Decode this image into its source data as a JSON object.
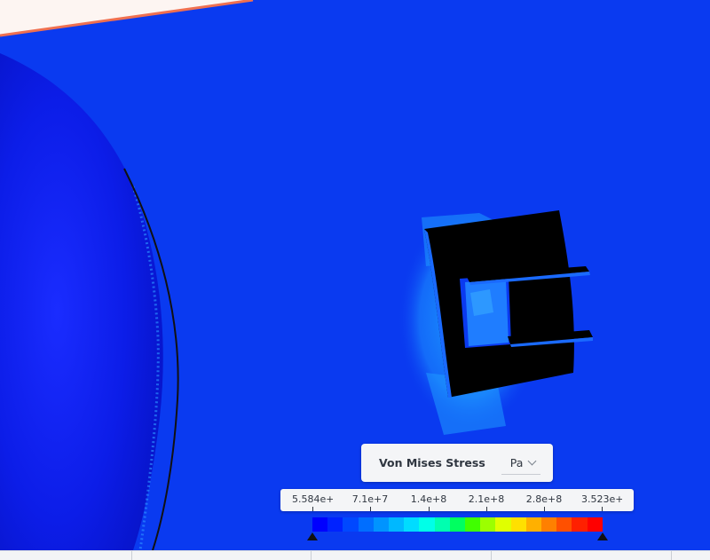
{
  "result_panel": {
    "quantity_label": "Von Mises Stress",
    "unit": "Pa"
  },
  "legend": {
    "labels": [
      "5.584e+5",
      "7.1e+7",
      "1.4e+8",
      "2.1e+8",
      "2.8e+8",
      "3.523e+8"
    ],
    "colors": [
      "#0000ff",
      "#0022ff",
      "#0048ff",
      "#006eff",
      "#0094ff",
      "#00b8ff",
      "#00dcff",
      "#00ffe8",
      "#00ffb0",
      "#00ff60",
      "#40ff00",
      "#9cff00",
      "#e0ff00",
      "#ffe000",
      "#ffb000",
      "#ff8000",
      "#ff5000",
      "#ff2000",
      "#ff0000"
    ]
  },
  "colors": {
    "background_blue": "#0a3af0",
    "body_blue": "#0a1ee6",
    "part_black": "#000000",
    "panel_bg": "#f4f5f7",
    "text_dark": "#2f3640"
  },
  "icons": {
    "unit_dropdown": "chevron-down-icon",
    "legend_min_handle": "triangle-up-icon",
    "legend_max_handle": "triangle-up-icon"
  }
}
